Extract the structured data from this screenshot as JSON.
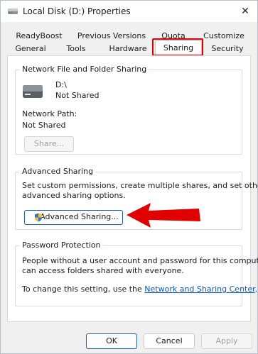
{
  "window": {
    "title": "Local Disk (D:) Properties",
    "close_glyph": "✕"
  },
  "tabs": {
    "back_row": [
      "ReadyBoost",
      "Previous Versions",
      "Quota",
      "Customize"
    ],
    "front_row": [
      "General",
      "Tools",
      "Hardware",
      "Sharing",
      "Security"
    ],
    "active": "Sharing"
  },
  "network_sharing": {
    "group_label": "Network File and Folder Sharing",
    "drive_path": "D:\\",
    "drive_status": "Not Shared",
    "network_path_label": "Network Path:",
    "network_path_value": "Not Shared",
    "share_button": "Share..."
  },
  "advanced_sharing": {
    "group_label": "Advanced Sharing",
    "description_line1": "Set custom permissions, create multiple shares, and set other",
    "description_line2": "advanced sharing options.",
    "button": "Advanced Sharing..."
  },
  "password_protection": {
    "group_label": "Password Protection",
    "line1": "People without a user account and password for this computer",
    "line2": "can access folders shared with everyone.",
    "line3_prefix": "To change this setting, use the ",
    "link": "Network and Sharing Center",
    "line3_suffix": "."
  },
  "footer": {
    "ok": "OK",
    "cancel": "Cancel",
    "apply": "Apply"
  },
  "colors": {
    "annotation_red": "#e00000",
    "link_blue": "#0a58ca",
    "primary_border": "#1a5fb4"
  }
}
